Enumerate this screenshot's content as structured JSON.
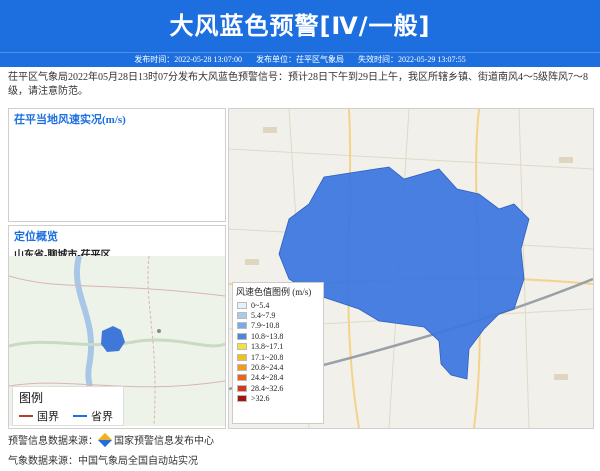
{
  "header": {
    "title": "大风蓝色预警[Ⅳ/一般]"
  },
  "meta": {
    "publish_time": "发布时间：2022-05-28 13:07:00",
    "publisher": "发布单位：茌平区气象局",
    "expire_time": "失效时间：2022-05-29 13:07:55"
  },
  "description": "茌平区气象局2022年05月28日13时07分发布大风蓝色预警信号：预计28日下午到29日上午，我区所辖乡镇、街道南风4～5级阵风7～8级，请注意防范。",
  "panels": {
    "wind_title": "茌平当地风速实况(m/s)",
    "location_title": "定位概览",
    "location_subtitle": "山东省-聊城市-茌平区",
    "small_legend": {
      "title": "图例",
      "country": "国界",
      "province": "省界"
    },
    "legend_title": "风速色值图例 (m/s)",
    "legend_items": [
      {
        "label": "0~5.4",
        "color": "#e8f0fb"
      },
      {
        "label": "5.4~7.9",
        "color": "#a9c9ef"
      },
      {
        "label": "7.9~10.8",
        "color": "#7aa9e6"
      },
      {
        "label": "10.8~13.8",
        "color": "#4b86dc"
      },
      {
        "label": "13.8~17.1",
        "color": "#f3e23a"
      },
      {
        "label": "17.1~20.8",
        "color": "#f0c020"
      },
      {
        "label": "20.8~24.4",
        "color": "#f39a1c"
      },
      {
        "label": "24.4~28.4",
        "color": "#e8661b"
      },
      {
        "label": "28.4~32.6",
        "color": "#d23a17"
      },
      {
        "label": ">32.6",
        "color": "#a11510"
      }
    ]
  },
  "footer": {
    "source1": "预警信息数据来源：",
    "source1_name": "国家预警信息发布中心",
    "source2": "气象数据来源：中国气象局全国自动站实况"
  }
}
